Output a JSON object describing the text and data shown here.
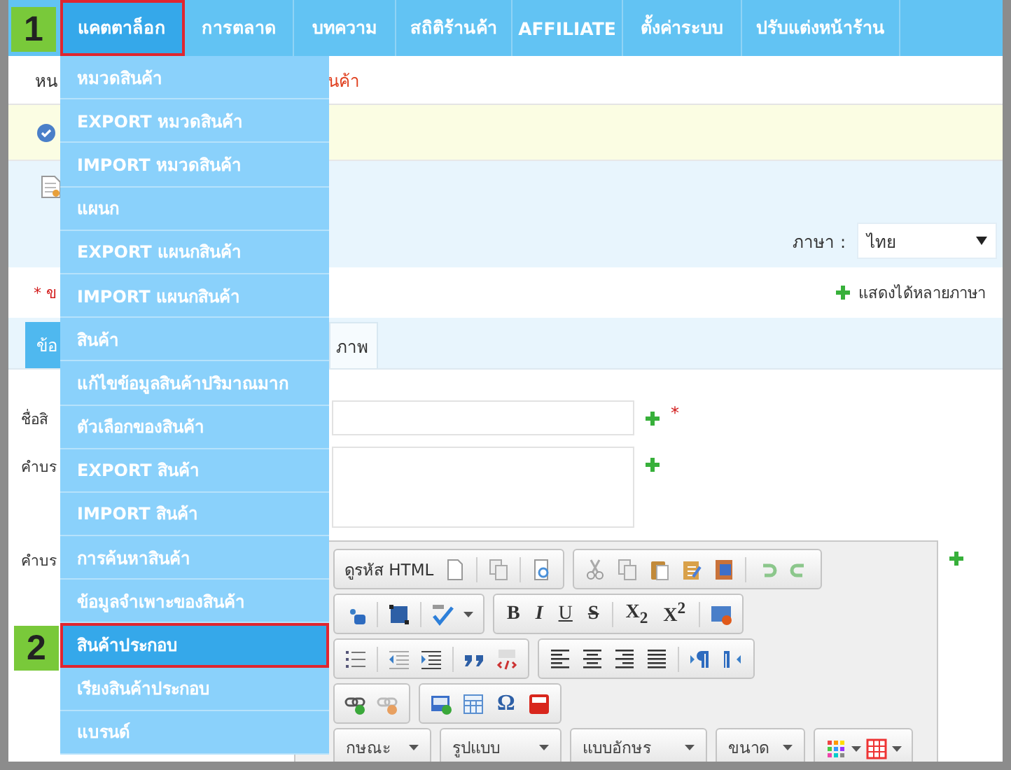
{
  "nav": {
    "items": [
      {
        "label": "แคตตาล็อก",
        "selected": true
      },
      {
        "label": "การตลาด",
        "selected": false
      },
      {
        "label": "บทความ",
        "selected": false
      },
      {
        "label": "สถิติร้านค้า",
        "selected": false
      },
      {
        "label": "AFFILIATE",
        "selected": false
      },
      {
        "label": "ตั้งค่าระบบ",
        "selected": false
      },
      {
        "label": "ปรับแต่งหน้าร้าน",
        "selected": false
      }
    ]
  },
  "step_badges": [
    "1",
    "2"
  ],
  "catalog_menu": {
    "items": [
      {
        "label": "หมวดสินค้า",
        "selected": false
      },
      {
        "label": "EXPORT หมวดสินค้า",
        "selected": false
      },
      {
        "label": "IMPORT หมวดสินค้า",
        "selected": false
      },
      {
        "label": "แผนก",
        "selected": false
      },
      {
        "label": "EXPORT แผนกสินค้า",
        "selected": false
      },
      {
        "label": "IMPORT แผนกสินค้า",
        "selected": false
      },
      {
        "label": "สินค้า",
        "selected": false
      },
      {
        "label": "แก้ไขข้อมูลสินค้าปริมาณมาก",
        "selected": false
      },
      {
        "label": "ตัวเลือกของสินค้า",
        "selected": false
      },
      {
        "label": "EXPORT สินค้า",
        "selected": false
      },
      {
        "label": "IMPORT สินค้า",
        "selected": false
      },
      {
        "label": "การค้นหาสินค้า",
        "selected": false
      },
      {
        "label": "ข้อมูลจำเพาะของสินค้า",
        "selected": false
      },
      {
        "label": "สินค้าประกอบ",
        "selected": true
      },
      {
        "label": "เรียงสินค้าประกอบ",
        "selected": false
      },
      {
        "label": "แบรนด์",
        "selected": false
      }
    ]
  },
  "breadcrumb": {
    "start": "หน",
    "end": "นค้า"
  },
  "language": {
    "label": "ภาษา :",
    "value": "ไทย"
  },
  "required_note": "* ข",
  "multi_language_note": "แสดงได้หลายภาษา",
  "tabs": [
    {
      "label": "ข้อ",
      "selected": true
    },
    {
      "label": "ภาพ",
      "selected": false
    }
  ],
  "form": {
    "name_label": "ชื่อสิ",
    "required_mark": "*",
    "short_label": "คำบร",
    "long_label": "คำบร"
  },
  "editor": {
    "source_label": "ดูรหัส HTML",
    "format_buttons": [
      "B",
      "I",
      "U",
      "S"
    ],
    "script_buttons": [
      "X$_{2}$",
      "X$^{2}$"
    ],
    "symbol_button": "Ω",
    "combos": [
      "กษณะ",
      "รูปแบบ",
      "แบบอักษร",
      "ขนาด"
    ]
  }
}
